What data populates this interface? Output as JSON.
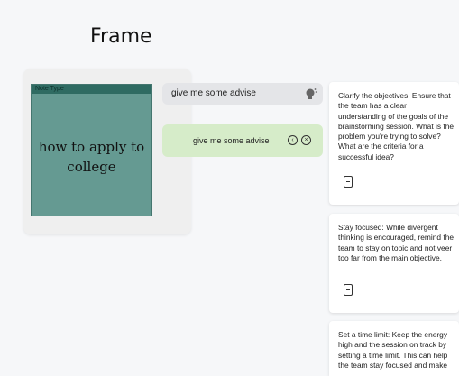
{
  "frame": {
    "title": "Frame",
    "note": {
      "header": "Note Type",
      "text": "how to apply to college"
    },
    "colors": {
      "note_bg": "#659a92",
      "note_header": "#2f6b62",
      "suggestion_bg": "#d6ecc9"
    }
  },
  "prompt": {
    "input_text": "give me some advise",
    "icon": "lightbulb-icon"
  },
  "suggestion": {
    "text": "give me some advise",
    "icons": [
      "accept-icon",
      "reject-icon"
    ]
  },
  "cards": [
    {
      "text": "Clarify the objectives: Ensure that the team has a clear understanding of the goals of the brainstorming session. What is the problem you're trying to solve? What are the criteria for a successful idea?",
      "icon": "add-note-icon"
    },
    {
      "text": "Stay focused: While divergent thinking is encouraged, remind the team to stay on topic and not veer too far from the main objective.",
      "icon": "add-note-icon"
    },
    {
      "text": "Set a time limit: Keep the energy high and the session on track by setting a time limit. This can help the team stay focused and make",
      "icon": "add-note-icon"
    }
  ]
}
